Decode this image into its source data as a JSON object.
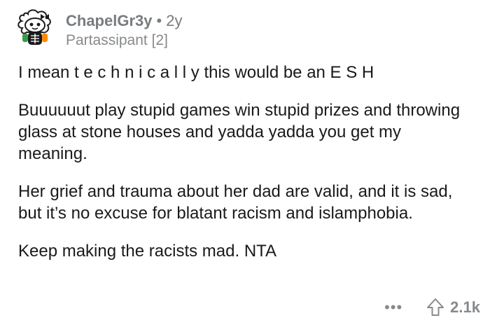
{
  "comment": {
    "username": "ChapelGr3y",
    "separator": "•",
    "age": "2y",
    "flair": "Partassipant [2]",
    "paragraphs": [
      "I mean t e c h n i c a l l y this would be an E S H",
      "Buuuuuut play stupid games win stupid prizes and throwing glass at stone houses and yadda yadda you get my meaning.",
      "Her grief and trauma about her dad are valid, and it is sad, but it’s no excuse for blatant racism and islamphobia.",
      "Keep making the racists mad. NTA"
    ],
    "more_label": "•••",
    "score": "2.1k"
  },
  "icons": {
    "avatar": "snoo-avatar-icon",
    "more": "more-options-icon",
    "upvote": "upvote-arrow-icon"
  }
}
